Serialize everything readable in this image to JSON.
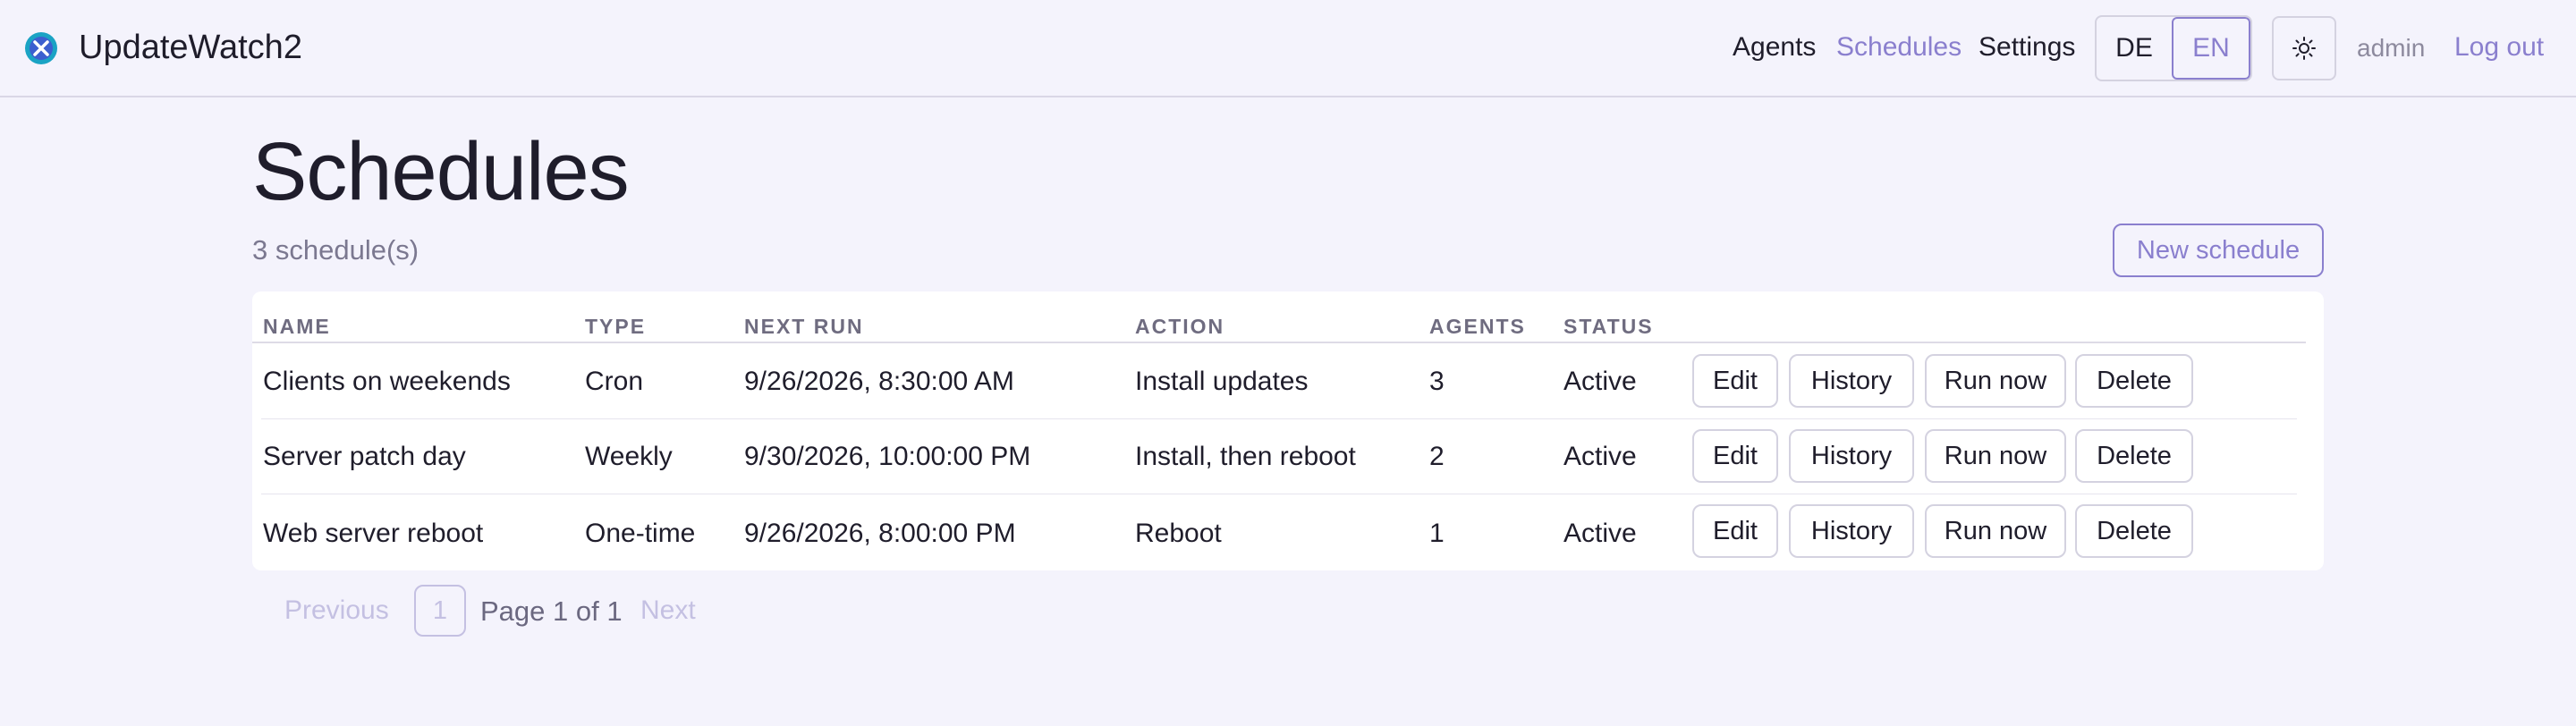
{
  "app": {
    "title": "UpdateWatch2",
    "accent": "#8a7fce"
  },
  "nav": {
    "items": [
      {
        "label": "Agents",
        "active": false
      },
      {
        "label": "Schedules",
        "active": true
      },
      {
        "label": "Settings",
        "active": false
      }
    ],
    "languages": [
      "DE",
      "EN"
    ],
    "selected_language": "EN",
    "theme_icon": "sun-icon",
    "user": "admin",
    "logout_label": "Log out"
  },
  "page": {
    "title": "Schedules",
    "count_text": "3 schedule(s)",
    "new_button": "New schedule"
  },
  "table": {
    "columns": [
      "NAME",
      "TYPE",
      "NEXT RUN",
      "ACTION",
      "AGENTS",
      "STATUS"
    ],
    "actions": [
      "Edit",
      "History",
      "Run now",
      "Delete"
    ],
    "rows": [
      {
        "name": "Clients on weekends",
        "type": "Cron",
        "next_run": "9/26/2026, 8:30:00 AM",
        "action": "Install updates",
        "agents": "3",
        "status": "Active"
      },
      {
        "name": "Server patch day",
        "type": "Weekly",
        "next_run": "9/30/2026, 10:00:00 PM",
        "action": "Install, then reboot",
        "agents": "2",
        "status": "Active"
      },
      {
        "name": "Web server reboot",
        "type": "One-time",
        "next_run": "9/26/2026, 8:00:00 PM",
        "action": "Reboot",
        "agents": "1",
        "status": "Active"
      }
    ]
  },
  "pagination": {
    "previous": "Previous",
    "current": "1",
    "label": "Page 1 of 1",
    "next": "Next"
  }
}
